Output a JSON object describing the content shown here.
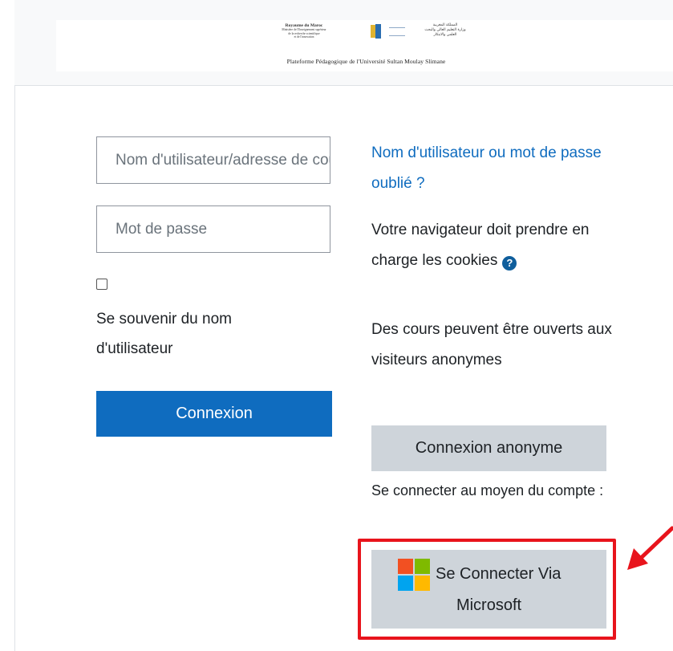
{
  "header": {
    "logo_left": {
      "line1": "Royaume du Maroc",
      "line2": "Ministère de l'Enseignement supérieur",
      "line3": "de la recherche scientifique",
      "line4": "et de l'innovation"
    },
    "logo_right": {
      "line1": "المملكة المغربية",
      "line2": "وزارة التعليم العالي والبحث",
      "line3": "العلمي والابتكار"
    },
    "platform_title": "Plateforme Pédagogique de l'Université Sultan Moulay Slimane"
  },
  "login_form": {
    "username_placeholder": "Nom d'utilisateur/adresse de courriel",
    "password_placeholder": "Mot de passe",
    "remember_label": "Se souvenir du nom d'utilisateur",
    "remember_checked": false,
    "submit_label": "Connexion"
  },
  "side_panel": {
    "forgot_link": "Nom d'utilisateur ou mot de passe oublié ?",
    "cookies_text": "Votre navigateur doit prendre en charge les cookies",
    "help_icon": "question-circle-icon",
    "guests_text": "Des cours peuvent être ouverts aux visiteurs anonymes",
    "guest_button_label": "Connexion anonyme",
    "idp_label": "Se connecter au moyen du compte :",
    "microsoft_button_line1": "Se Connecter Via",
    "microsoft_button_line2": "Microsoft"
  },
  "colors": {
    "primary": "#0f6cbf",
    "secondary_button": "#ced4da",
    "highlight": "#e8141c",
    "ms_red": "#f25022",
    "ms_green": "#7fba00",
    "ms_blue": "#00a4ef",
    "ms_yellow": "#ffb900"
  }
}
